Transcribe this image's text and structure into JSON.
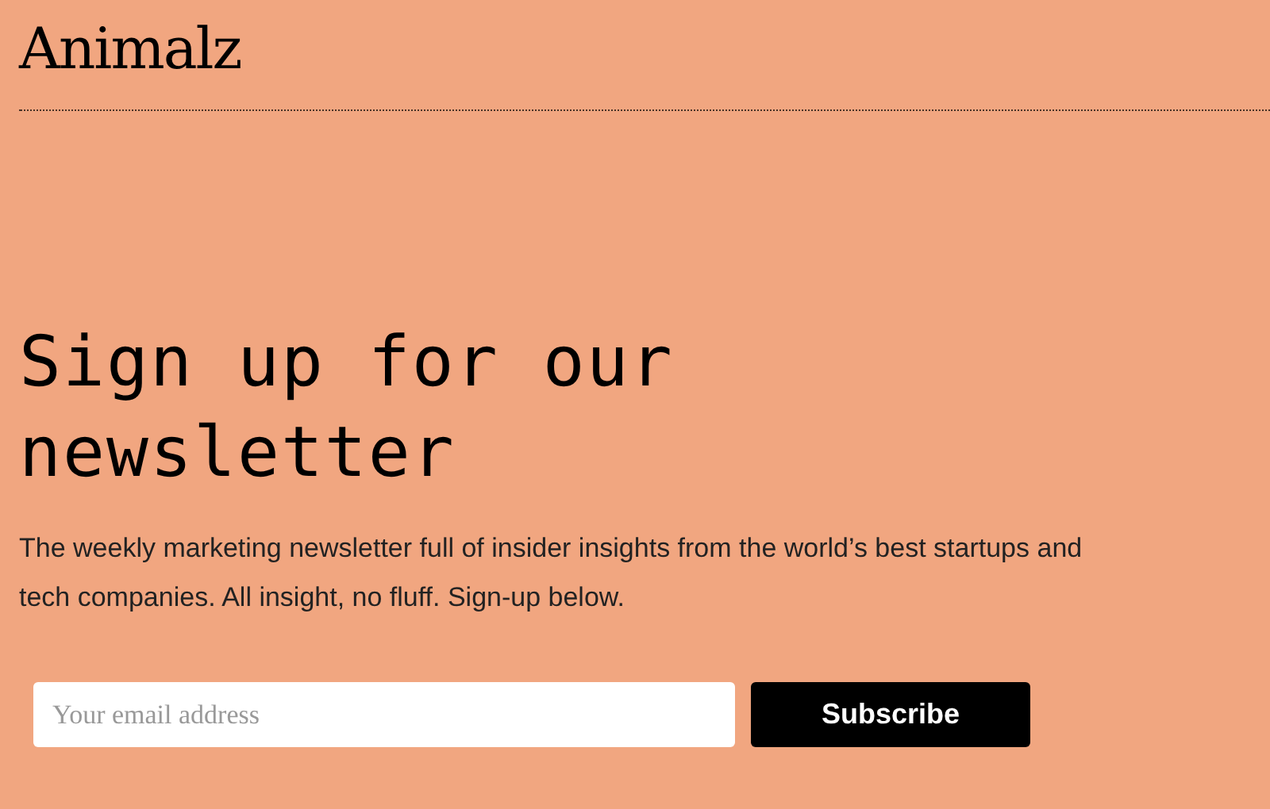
{
  "logo": "Animalz",
  "heading": "Sign up for our newsletter",
  "description": "The weekly marketing newsletter full of insider insights from the world’s best startups and tech companies. All insight, no fluff. Sign-up below.",
  "form": {
    "email": {
      "placeholder": "Your email address"
    },
    "button": "Subscribe"
  }
}
